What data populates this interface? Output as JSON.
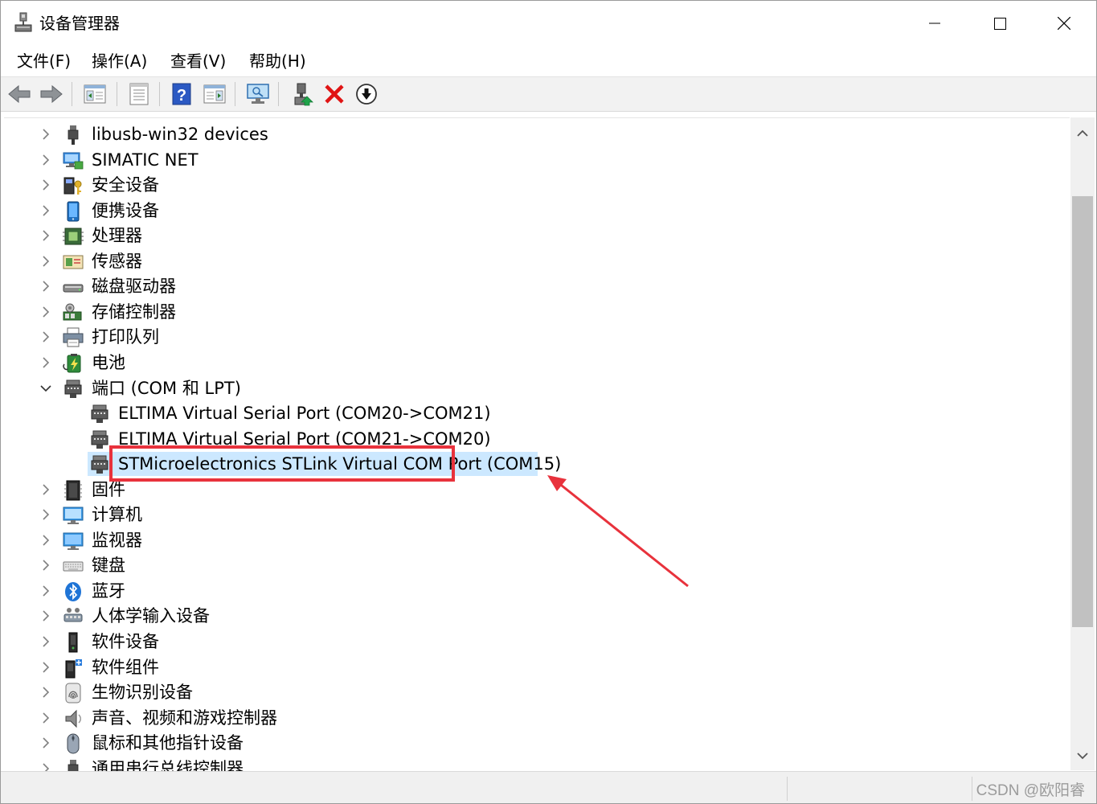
{
  "window": {
    "title": "设备管理器",
    "controls": {
      "minimize": "minimize",
      "maximize": "maximize",
      "close": "close"
    }
  },
  "menu": [
    "文件(F)",
    "操作(A)",
    "查看(V)",
    "帮助(H)"
  ],
  "toolbar": {
    "buttons": [
      "back-icon",
      "forward-icon",
      "show-hide-console-tree-icon",
      "properties-icon",
      "help-icon",
      "action-pane-icon",
      "scan-hardware-icon",
      "update-driver-icon",
      "uninstall-icon",
      "disable-device-icon"
    ]
  },
  "tree": {
    "top_items": [
      {
        "label": "libusb-win32 devices",
        "icon": "usb-plug-icon"
      },
      {
        "label": "SIMATIC NET",
        "icon": "network-computer-icon"
      },
      {
        "label": "安全设备",
        "icon": "security-key-icon"
      },
      {
        "label": "便携设备",
        "icon": "portable-device-icon"
      },
      {
        "label": "处理器",
        "icon": "processor-icon"
      },
      {
        "label": "传感器",
        "icon": "sensor-icon"
      },
      {
        "label": "磁盘驱动器",
        "icon": "disk-drive-icon"
      },
      {
        "label": "存储控制器",
        "icon": "storage-controller-icon"
      },
      {
        "label": "打印队列",
        "icon": "printer-icon"
      },
      {
        "label": "电池",
        "icon": "battery-icon"
      }
    ],
    "ports_category": {
      "label": "端口 (COM 和 LPT)",
      "icon": "port-connector-icon",
      "expanded": true
    },
    "ports": [
      {
        "label": "ELTIMA Virtual Serial Port (COM20->COM21)",
        "icon": "port-connector-icon"
      },
      {
        "label": "ELTIMA Virtual Serial Port (COM21->COM20)",
        "icon": "port-connector-icon"
      },
      {
        "label": "STMicroelectronics STLink Virtual COM Port (COM15)",
        "icon": "port-connector-icon",
        "selected": true
      }
    ],
    "bottom_items": [
      {
        "label": "固件",
        "icon": "firmware-chip-icon"
      },
      {
        "label": "计算机",
        "icon": "computer-monitor-icon"
      },
      {
        "label": "监视器",
        "icon": "monitor-icon"
      },
      {
        "label": "键盘",
        "icon": "keyboard-icon"
      },
      {
        "label": "蓝牙",
        "icon": "bluetooth-icon"
      },
      {
        "label": "人体学输入设备",
        "icon": "hid-icon"
      },
      {
        "label": "软件设备",
        "icon": "software-device-icon"
      },
      {
        "label": "软件组件",
        "icon": "software-component-icon"
      },
      {
        "label": "生物识别设备",
        "icon": "fingerprint-icon"
      },
      {
        "label": "声音、视频和游戏控制器",
        "icon": "speaker-icon"
      },
      {
        "label": "鼠标和其他指针设备",
        "icon": "mouse-icon"
      },
      {
        "label": "通用串行总线控制器",
        "icon": "usb-plug-icon"
      }
    ]
  },
  "status": {
    "watermark": "CSDN @欧阳睿"
  },
  "annotation": {
    "highlight_color": "#e8323c",
    "arrow_color": "#e8323c"
  },
  "colors": {
    "selection": "#cce8ff",
    "scroll_thumb": "#c1c1c1"
  }
}
